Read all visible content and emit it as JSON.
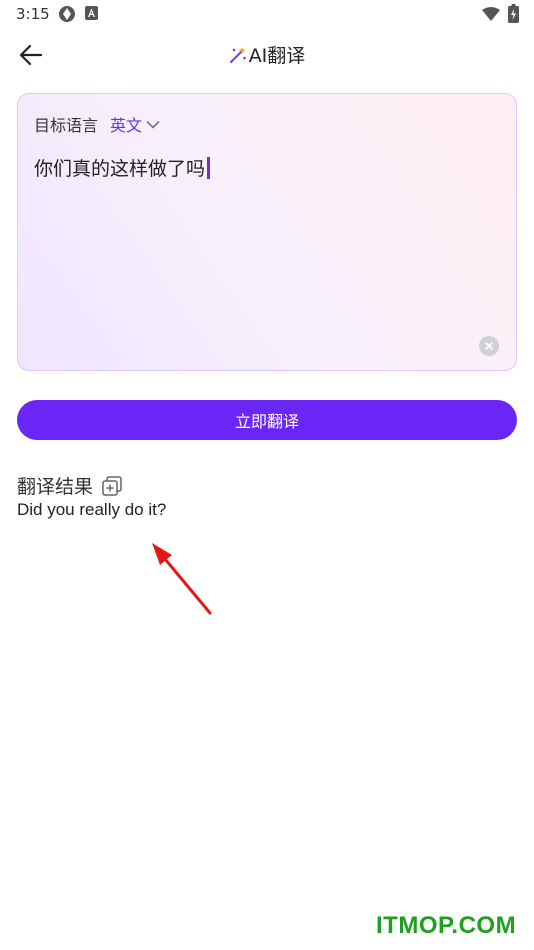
{
  "status_bar": {
    "time": "3:15"
  },
  "header": {
    "title": "AI翻译"
  },
  "input_card": {
    "lang_label": "目标语言",
    "lang_value": "英文",
    "input_text": "你们真的这样做了吗"
  },
  "translate_button": {
    "label": "立即翻译"
  },
  "result": {
    "heading": "翻译结果",
    "text": "Did you really do it?"
  },
  "watermark": "ITMOP.COM",
  "colors": {
    "accent": "#6a26f5",
    "accent_text": "#6b2ee0",
    "card_border": "#dfc8ff",
    "annotation_arrow": "#e01818",
    "watermark": "#1fa01f"
  },
  "icons": [
    "back-arrow-icon",
    "sparkle-wand-icon",
    "chevron-down-icon",
    "clear-icon",
    "copy-icon",
    "wifi-icon",
    "battery-icon"
  ]
}
